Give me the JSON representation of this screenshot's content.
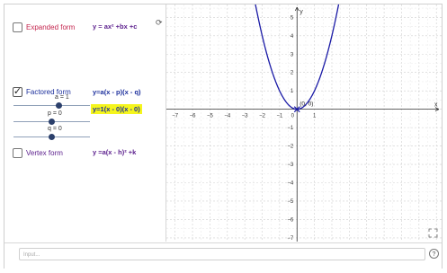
{
  "algebra": {
    "expanded": {
      "label": "Expanded form",
      "checked": false,
      "equation": "y = ax² +bx +c"
    },
    "factored": {
      "label": "Factored form",
      "checked": true,
      "equation": "y=a(x - p)(x - q)",
      "highlight": "y=1(x - 0)(x - 0)"
    },
    "sliders": [
      {
        "name": "a",
        "text": "a = 1",
        "value": 1,
        "min": -5,
        "max": 5
      },
      {
        "name": "p",
        "text": "p = 0",
        "value": 0,
        "min": -5,
        "max": 5
      },
      {
        "name": "q",
        "text": "q = 0",
        "value": 0,
        "min": -5,
        "max": 5
      }
    ],
    "vertex": {
      "label": "Vertex form",
      "checked": false,
      "equation": "y =a(x - h)² +k"
    }
  },
  "graph": {
    "x_label": "x",
    "y_label": "y",
    "x_ticks": [
      "−7",
      "−6",
      "−5",
      "−4",
      "−3",
      "−2",
      "−1",
      "0",
      "1"
    ],
    "y_ticks_pos": [
      "1",
      "2",
      "3",
      "4",
      "5"
    ],
    "y_ticks_neg": [
      "−1",
      "−2",
      "−3",
      "−4",
      "−5",
      "−6",
      "−7"
    ],
    "point_label": "(0, 0)",
    "curve_color": "#1a1aa6",
    "xlim": [
      -7.5,
      8.3
    ],
    "ylim": [
      -7.2,
      5.7
    ]
  },
  "input_bar": {
    "placeholder": "Input..."
  },
  "icons": {
    "help": "?"
  },
  "colors": {
    "red": "#c4254e",
    "purple": "#5a1d8c",
    "blue": "#1c2f9c",
    "highlight": "#f5f51c"
  }
}
